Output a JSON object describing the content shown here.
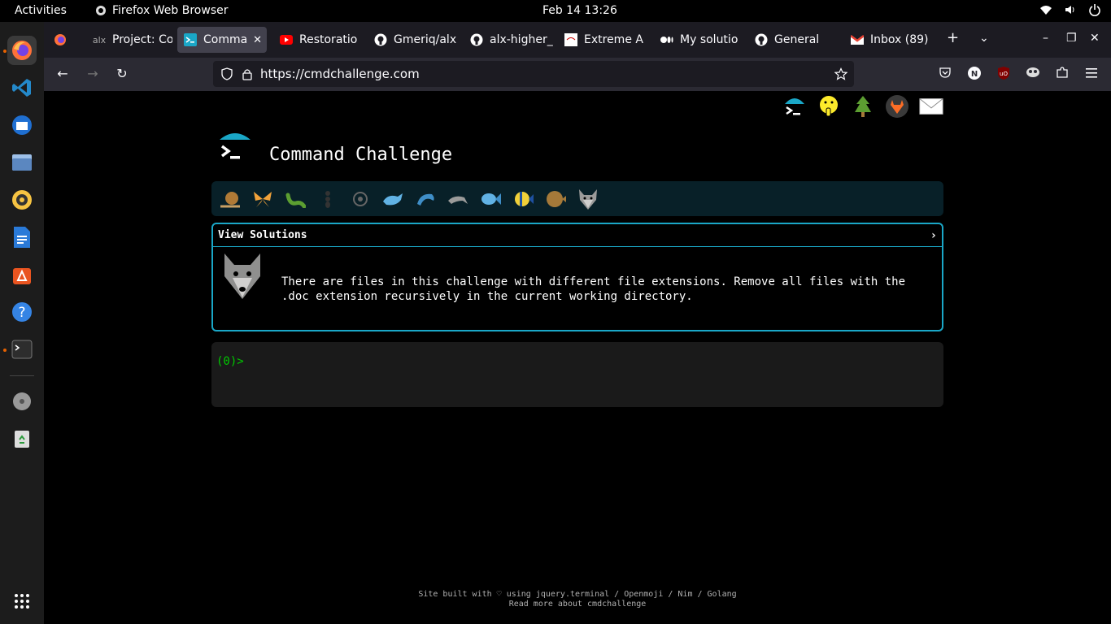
{
  "topbar": {
    "activities": "Activities",
    "app_name": "Firefox Web Browser",
    "clock": "Feb 14  13:26"
  },
  "dock": {
    "items": [
      "firefox",
      "vscode",
      "thunderbird",
      "files",
      "rhythmbox",
      "writer",
      "app-center",
      "help",
      "terminal",
      "disk",
      "trash"
    ]
  },
  "tabs": [
    {
      "title": "Project: Co",
      "icon": "alx-icon"
    },
    {
      "title": "Comman",
      "icon": "terminal-icon",
      "selected": true
    },
    {
      "title": "Restoratio",
      "icon": "youtube-icon"
    },
    {
      "title": "Gmeriq/alx",
      "icon": "github-icon"
    },
    {
      "title": "alx-higher_",
      "icon": "github-icon"
    },
    {
      "title": "Extreme A",
      "icon": "page-icon"
    },
    {
      "title": "My solutio",
      "icon": "medium-icon"
    },
    {
      "title": "General",
      "icon": "github-icon"
    },
    {
      "title": "Inbox (89)",
      "icon": "gmail-icon"
    }
  ],
  "navbar": {
    "url": "https://cmdchallenge.com"
  },
  "page": {
    "title": "Command Challenge",
    "view_solutions": "View Solutions",
    "chevron": "›",
    "description": "There are files in this challenge with different file extensions. Remove all files with the .doc extension recursively in the current working directory.",
    "prompt": "(0)>",
    "footer_line1": "Site built with ♡ using jquery.terminal / Openmoji / Nim / Golang",
    "footer_line2": "Read more about cmdchallenge"
  },
  "colors": {
    "accent": "#1aa7c7",
    "prompt_green": "#00c800",
    "level_bar": "#082028",
    "terminal_bg": "#1a1a1a"
  }
}
